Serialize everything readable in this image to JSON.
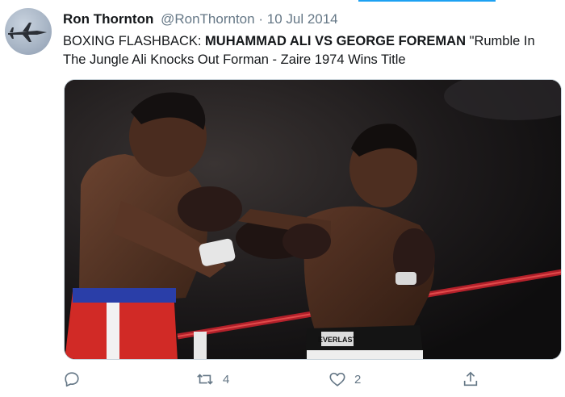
{
  "tweet": {
    "author_name": "Ron Thornton",
    "handle": "@RonThornton",
    "separator": "·",
    "date": "10 Jul 2014",
    "text_part1": "BOXING FLASHBACK: ",
    "text_bold": "MUHAMMAD ALI VS GEORGE FOREMAN",
    "text_part2": " \"Rumble In The Jungle Ali Knocks Out Forman - Zaire 1974 Wins Title",
    "media_label": "EVERLAST"
  },
  "actions": {
    "reply_icon": "reply-icon",
    "retweet_icon": "retweet-icon",
    "retweet_count": "4",
    "like_icon": "heart-icon",
    "like_count": "2",
    "share_icon": "share-icon"
  },
  "colors": {
    "accent": "#1da1f2",
    "secondary_text": "#657786",
    "primary_text": "#14171a"
  }
}
